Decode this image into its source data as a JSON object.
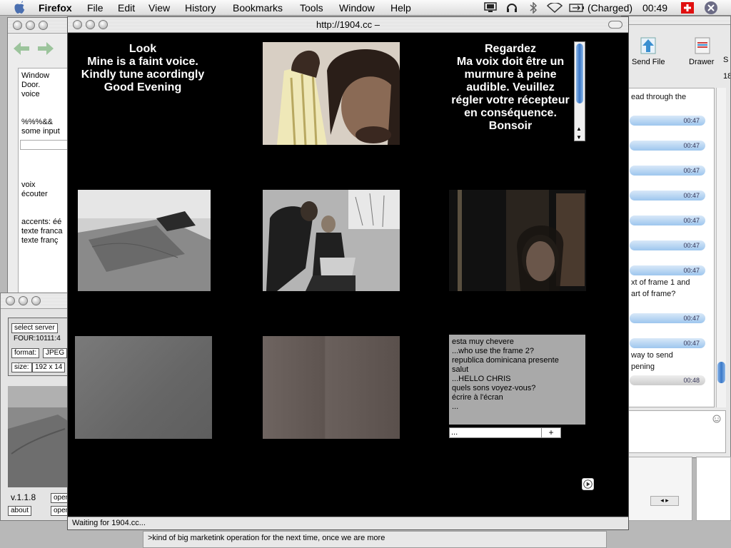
{
  "menubar": {
    "app": "Firefox",
    "items": [
      "File",
      "Edit",
      "View",
      "History",
      "Bookmarks",
      "Tools",
      "Window",
      "Help"
    ],
    "battery": "(Charged)",
    "clock": "00:49"
  },
  "browser": {
    "title": "http://1904.cc –",
    "status": "Waiting for 1904.cc...",
    "intro_en": [
      "Look",
      "Mine is a faint voice.",
      "Kindly tune acordingly",
      "Good Evening"
    ],
    "intro_fr": [
      "Regardez",
      "Ma voix doit être un",
      "murmure à peine",
      "audible. Veuillez",
      "régler votre récepteur",
      "en conséquence.",
      "Bonsoir"
    ],
    "chat": [
      "esta muy chevere",
      "...who use the frame 2?",
      "republica dominicana presente",
      "salut",
      "...HELLO CHRIS",
      "quels sons voyez-vous?",
      "écrire à l'écran",
      "..."
    ],
    "chat_input": "...",
    "chat_send": "+"
  },
  "left_window": {
    "lines": [
      "Window",
      "Door.",
      "voice",
      "",
      "",
      "%%%&&",
      "some input",
      "",
      "",
      "",
      "",
      "",
      "voix",
      "écouter",
      "",
      "",
      "accents: éé",
      "texte franca",
      "texte franç"
    ]
  },
  "left_window2": {
    "select_server": "select server",
    "server": "FOUR:10111:4",
    "format_label": "format:",
    "format": "JPEG",
    "size_label": "size:",
    "size": "192 x 14",
    "version": "v.1.1.8",
    "about": "about",
    "open1": "open",
    "open2": "open"
  },
  "right_window": {
    "send_file": "Send File",
    "drawer": "Drawer",
    "edge_text": "S",
    "edge_num": "18",
    "times": [
      "00:47",
      "00:47",
      "00:47",
      "00:47",
      "00:47",
      "00:47",
      "00:47",
      "00:47",
      "00:47",
      "00:48"
    ],
    "texts": [
      "ead through the",
      "xt of frame 1 and",
      "art of frame?",
      " way to send",
      "pening"
    ]
  },
  "bottom_text": ">kind of big marketink operation for the next time, once we are more"
}
